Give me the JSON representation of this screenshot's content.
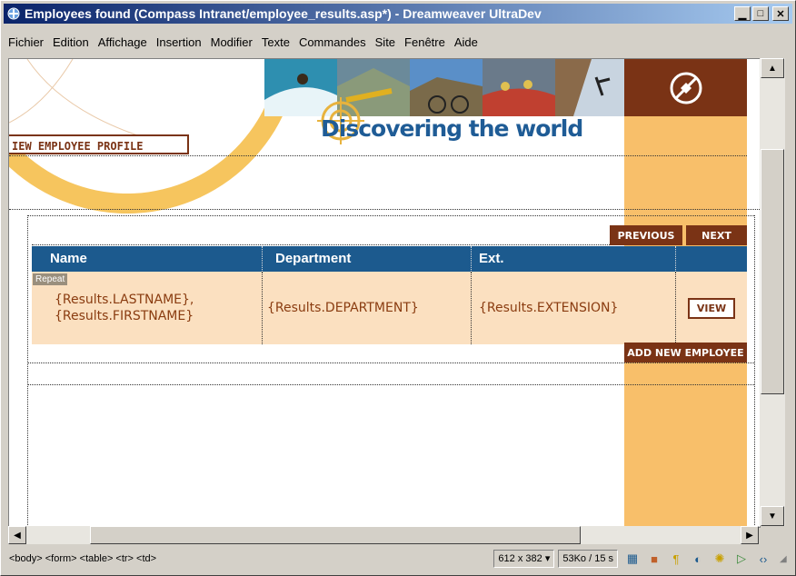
{
  "window": {
    "title": "Employees found (Compass Intranet/employee_results.asp*) - Dreamweaver UltraDev",
    "controls": [
      "minimize",
      "maximize",
      "close"
    ]
  },
  "menubar": {
    "items": [
      "Fichier",
      "Edition",
      "Affichage",
      "Insertion",
      "Modifier",
      "Texte",
      "Commandes",
      "Site",
      "Fenêtre",
      "Aide"
    ]
  },
  "page": {
    "heading": "Discovering the world",
    "section_label": "IEW EMPLOYEE PROFILE",
    "previous_label": "PREVIOUS",
    "next_label": "NEXT",
    "add_label": "ADD NEW EMPLOYEE",
    "repeat_tag": "Repeat",
    "table": {
      "headers": [
        "Name",
        "Department",
        "Ext."
      ],
      "row": {
        "name_line1": "{Results.LASTNAME},",
        "name_line2": "{Results.FIRSTNAME}",
        "department": "{Results.DEPARTMENT}",
        "extension": "{Results.EXTENSION}",
        "view_label": "VIEW"
      }
    },
    "colors": {
      "brown": "#7a3315",
      "blue": "#1c5a8e",
      "orange": "#f8bf6a"
    }
  },
  "statusbar": {
    "tag_selector": "<body> <form> <table> <tr> <td>",
    "window_size": "612 x 382",
    "download": "53Ko / 15 s",
    "launcher_icons": [
      "site-map-icon",
      "library-icon",
      "html-styles-icon",
      "behaviors-icon",
      "assets-icon",
      "timeline-icon",
      "code-inspector-icon"
    ]
  }
}
